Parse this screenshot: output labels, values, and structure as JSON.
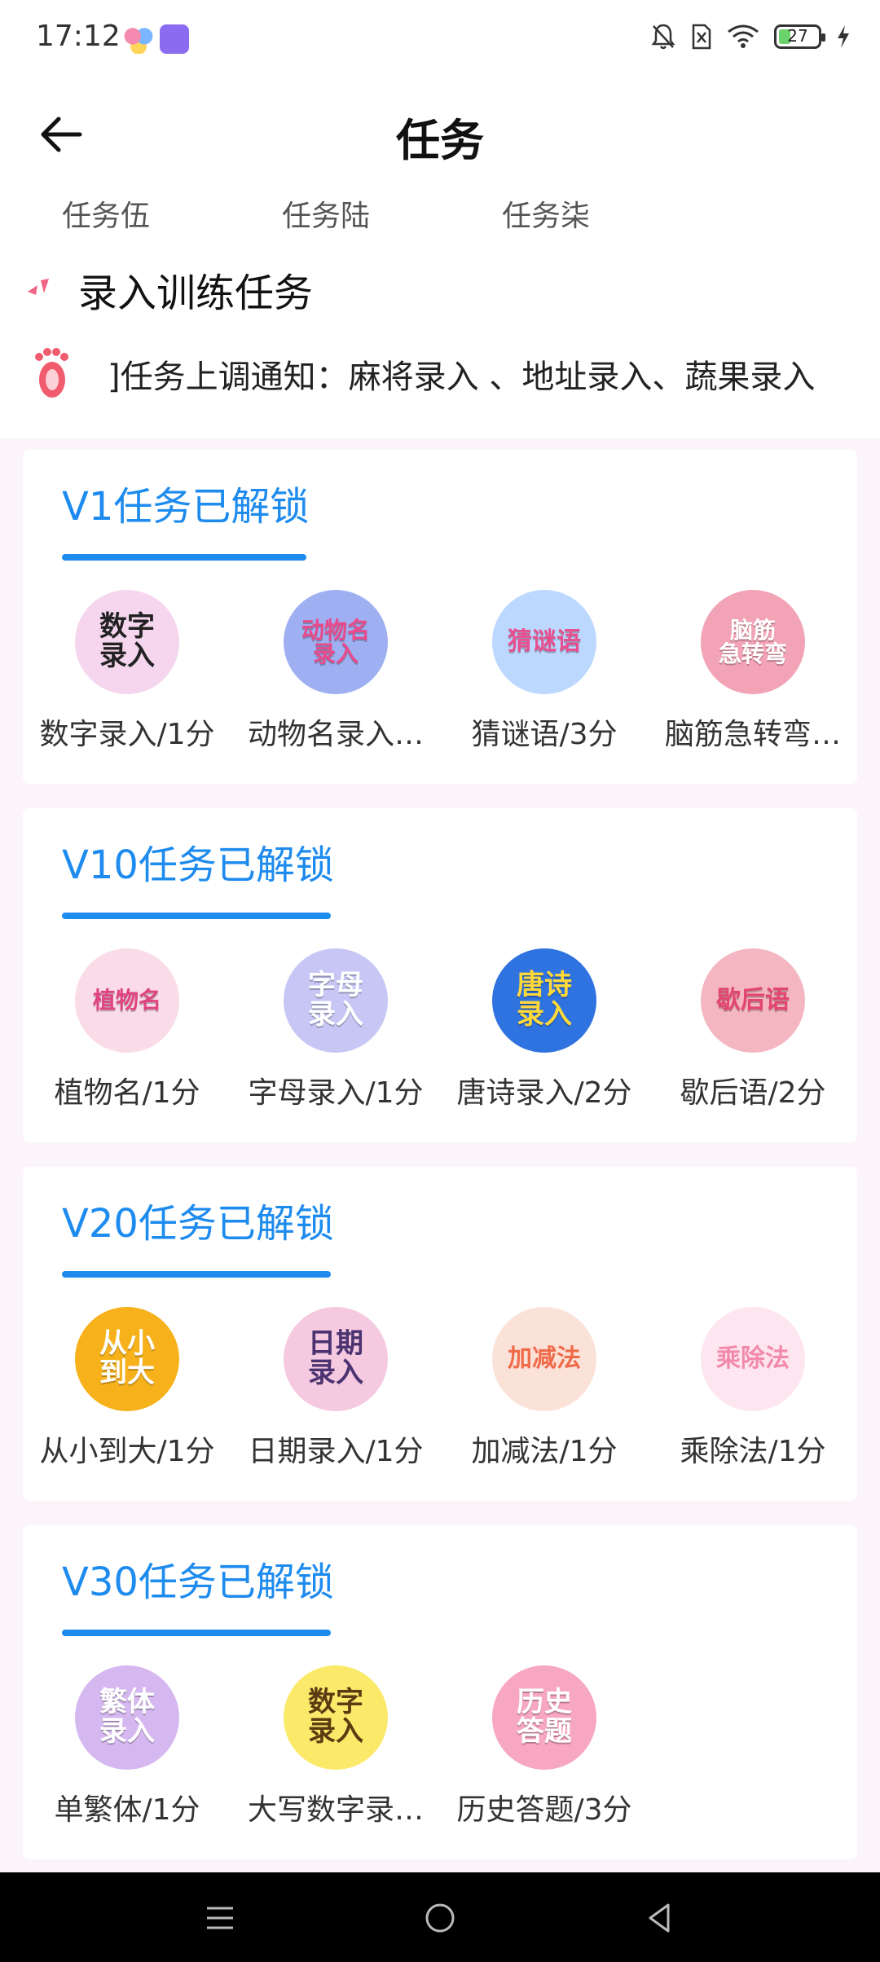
{
  "status": {
    "time": "17:12",
    "battery": "27"
  },
  "header": {
    "title": "任务"
  },
  "tabs": [
    "任务伍",
    "任务陆",
    "任务柒"
  ],
  "section": {
    "title": "录入训练任务"
  },
  "notice": {
    "text": "]任务上调通知：麻将录入 、地址录入、蔬果录入"
  },
  "cards": [
    {
      "title": "V1任务已解锁",
      "tasks": [
        {
          "label": "数字录入/1分",
          "icon_text": "数字\n录入",
          "color": "#f6d6ee",
          "ink": "#222"
        },
        {
          "label": "动物名录入…",
          "icon_text": "动物名\n录入",
          "color": "#9fb0f2",
          "ink": "#e94a8a"
        },
        {
          "label": "猜谜语/3分",
          "icon_text": "猜谜语",
          "color": "#bcd8ff",
          "ink": "#e84f8f"
        },
        {
          "label": "脑筋急转弯…",
          "icon_text": "脑筋\n急转弯",
          "color": "#f3a3b6",
          "ink": "#ffffff"
        }
      ]
    },
    {
      "title": "V10任务已解锁",
      "tasks": [
        {
          "label": "植物名/1分",
          "icon_text": "植物名",
          "color": "#fadbe8",
          "ink": "#e0437f"
        },
        {
          "label": "字母录入/1分",
          "icon_text": "字母\n录入",
          "color": "#c7c6f5",
          "ink": "#ffffff"
        },
        {
          "label": "唐诗录入/2分",
          "icon_text": "唐诗\n录入",
          "color": "#2f73e0",
          "ink": "#ffd93a"
        },
        {
          "label": "歇后语/2分",
          "icon_text": "歇后语",
          "color": "#f4b7c2",
          "ink": "#e3466f"
        }
      ]
    },
    {
      "title": "V20任务已解锁",
      "tasks": [
        {
          "label": "从小到大/1分",
          "icon_text": "从小\n到大",
          "color": "#f7b21b",
          "ink": "#ffffff"
        },
        {
          "label": "日期录入/1分",
          "icon_text": "日期\n录入",
          "color": "#f5c9df",
          "ink": "#4a3370"
        },
        {
          "label": "加减法/1分",
          "icon_text": "加减法",
          "color": "#fbe2d9",
          "ink": "#ef6b4a"
        },
        {
          "label": "乘除法/1分",
          "icon_text": "乘除法",
          "color": "#fde6ef",
          "ink": "#f28aad"
        }
      ]
    },
    {
      "title": "V30任务已解锁",
      "tasks": [
        {
          "label": "单繁体/1分",
          "icon_text": "繁体\n录入",
          "color": "#d6b8f0",
          "ink": "#ffffff"
        },
        {
          "label": "大写数字录…",
          "icon_text": "数字\n录入",
          "color": "#fbe96a",
          "ink": "#5a3b12"
        },
        {
          "label": "历史答题/3分",
          "icon_text": "历史\n答题",
          "color": "#f7a7c1",
          "ink": "#ffffff"
        }
      ]
    }
  ]
}
